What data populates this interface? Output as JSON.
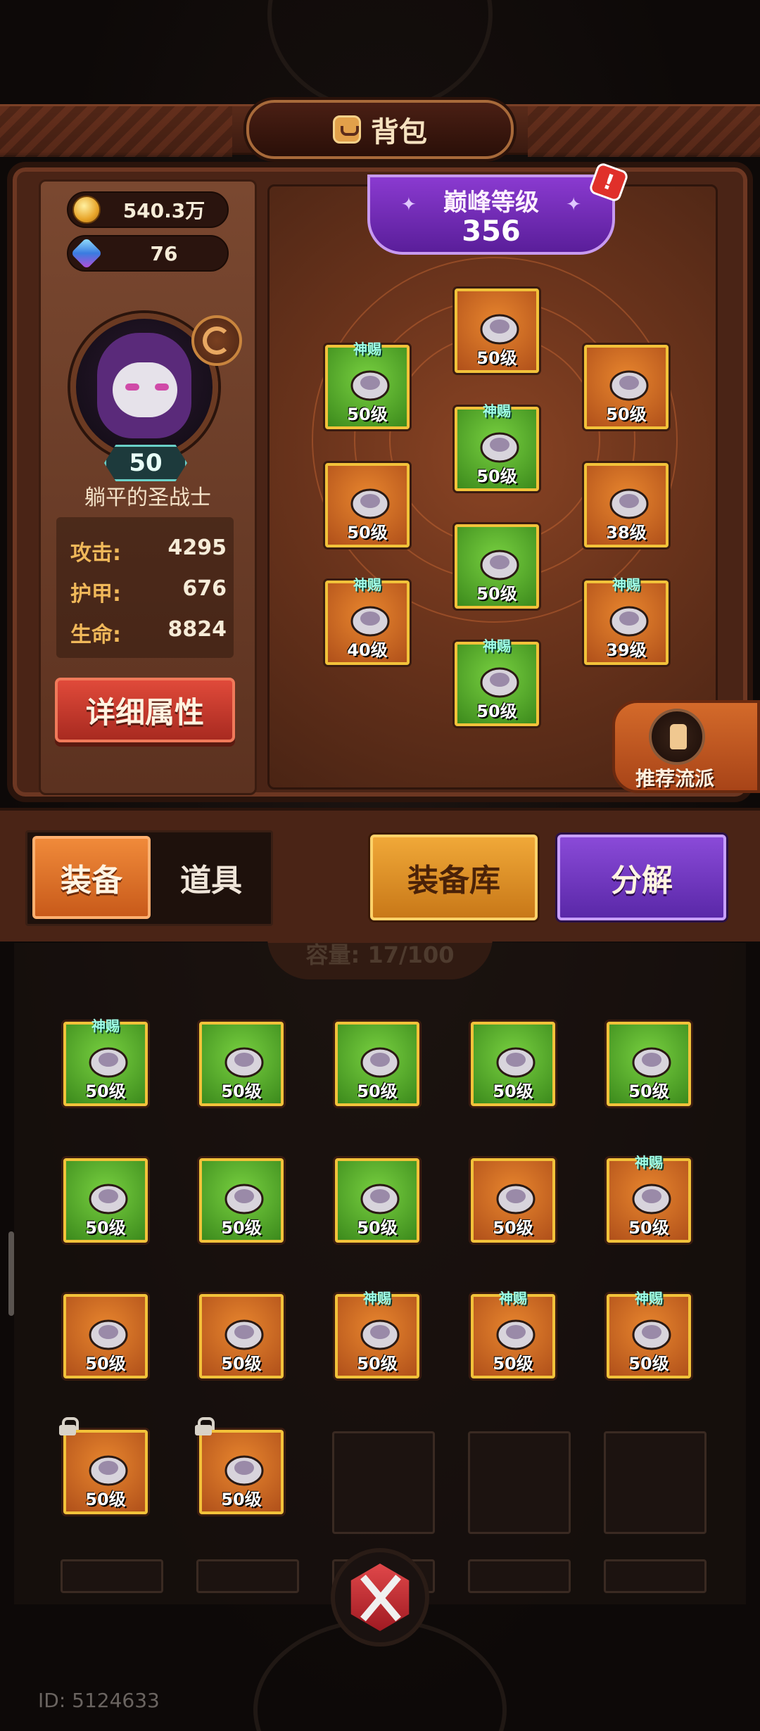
{
  "header": {
    "title": "背包",
    "icon": "bag-icon"
  },
  "currency": {
    "gold": "540.3万",
    "gems": "76"
  },
  "character": {
    "level": "50",
    "name": "躺平的圣战士"
  },
  "stats": [
    {
      "label": "攻击:",
      "value": "4295"
    },
    {
      "label": "护甲:",
      "value": "676"
    },
    {
      "label": "生命:",
      "value": "8824"
    }
  ],
  "detail_button": "详细属性",
  "peak": {
    "label": "巅峰等级",
    "value": "356",
    "alert": "!"
  },
  "equipped": [
    {
      "name": "helmet",
      "level": "50级",
      "rarity": "orange",
      "tag": ""
    },
    {
      "name": "shoulder",
      "level": "50级",
      "rarity": "green",
      "tag": "神赐"
    },
    {
      "name": "amulet",
      "level": "50级",
      "rarity": "orange",
      "tag": ""
    },
    {
      "name": "chest",
      "level": "50级",
      "rarity": "green",
      "tag": "神赐"
    },
    {
      "name": "gloves",
      "level": "50级",
      "rarity": "orange",
      "tag": ""
    },
    {
      "name": "ring",
      "level": "38级",
      "rarity": "orange",
      "tag": ""
    },
    {
      "name": "legs",
      "level": "50级",
      "rarity": "green",
      "tag": ""
    },
    {
      "name": "weapon",
      "level": "40级",
      "rarity": "orange",
      "tag": "神赐"
    },
    {
      "name": "trinket",
      "level": "39级",
      "rarity": "orange",
      "tag": "神赐"
    },
    {
      "name": "boots",
      "level": "50级",
      "rarity": "green",
      "tag": "神赐"
    }
  ],
  "recommend": {
    "label": "推荐流派"
  },
  "tabs": {
    "equip": "装备",
    "items": "道具"
  },
  "buttons": {
    "warehouse": "装备库",
    "dismantle": "分解"
  },
  "capacity": "容量: 17/100",
  "inventory": [
    {
      "level": "50级",
      "rarity": "green",
      "tag": "神赐",
      "locked": false
    },
    {
      "level": "50级",
      "rarity": "green",
      "tag": "",
      "locked": false
    },
    {
      "level": "50级",
      "rarity": "green",
      "tag": "",
      "locked": false
    },
    {
      "level": "50级",
      "rarity": "green",
      "tag": "",
      "locked": false
    },
    {
      "level": "50级",
      "rarity": "green",
      "tag": "",
      "locked": false
    },
    {
      "level": "50级",
      "rarity": "green",
      "tag": "",
      "locked": false
    },
    {
      "level": "50级",
      "rarity": "green",
      "tag": "",
      "locked": false
    },
    {
      "level": "50级",
      "rarity": "green",
      "tag": "",
      "locked": false
    },
    {
      "level": "50级",
      "rarity": "orange",
      "tag": "",
      "locked": false
    },
    {
      "level": "50级",
      "rarity": "orange",
      "tag": "神赐",
      "locked": false
    },
    {
      "level": "50级",
      "rarity": "orange",
      "tag": "",
      "locked": false
    },
    {
      "level": "50级",
      "rarity": "orange",
      "tag": "",
      "locked": false
    },
    {
      "level": "50级",
      "rarity": "orange",
      "tag": "神赐",
      "locked": false
    },
    {
      "level": "50级",
      "rarity": "orange",
      "tag": "神赐",
      "locked": false
    },
    {
      "level": "50级",
      "rarity": "orange",
      "tag": "神赐",
      "locked": false
    },
    {
      "level": "50级",
      "rarity": "orange",
      "tag": "",
      "locked": true
    },
    {
      "level": "50级",
      "rarity": "orange",
      "tag": "",
      "locked": true
    }
  ],
  "user_id": "ID: 5124633",
  "colors": {
    "slot_orange": "#d46e26",
    "slot_green": "#5aac2e",
    "slot_border": "#f2c23a",
    "peak_purple": "#6a2ab8"
  }
}
